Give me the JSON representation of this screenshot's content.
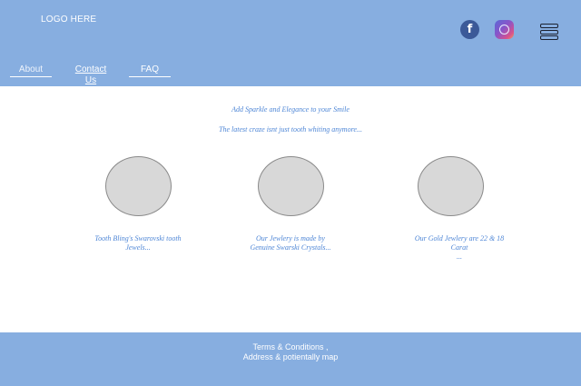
{
  "header": {
    "logo": "LOGO HERE",
    "nav": [
      {
        "label": "About"
      },
      {
        "label": "Contact Us"
      },
      {
        "label": "FAQ"
      }
    ],
    "social": {
      "facebook_glyph": "f",
      "facebook_icon": "facebook-icon",
      "instagram_icon": "instagram-icon",
      "menu_icon": "hamburger-menu-icon"
    }
  },
  "main": {
    "tagline": "Add Sparkle and Elegance to your Smile",
    "subtagline": "The latest craze isnt just tooth whiting anymore...",
    "features": [
      {
        "caption_line1": "Tooth Bling's Swarovski tooth",
        "caption_line2": "Jewels..."
      },
      {
        "caption_line1": "Our Jewlery is made by",
        "caption_line2": "Genuine Swarski Crystals..."
      },
      {
        "caption_line1": "Our Gold Jewlery are 22 & 18 Carat",
        "caption_line2": "..."
      }
    ]
  },
  "footer": {
    "line1": "Terms & Conditions ,",
    "line2": "Address & potientally map"
  },
  "colors": {
    "header_bg": "#87aee0",
    "text_accent": "#4e86d6",
    "placeholder_circle": "#d8d8d8"
  }
}
